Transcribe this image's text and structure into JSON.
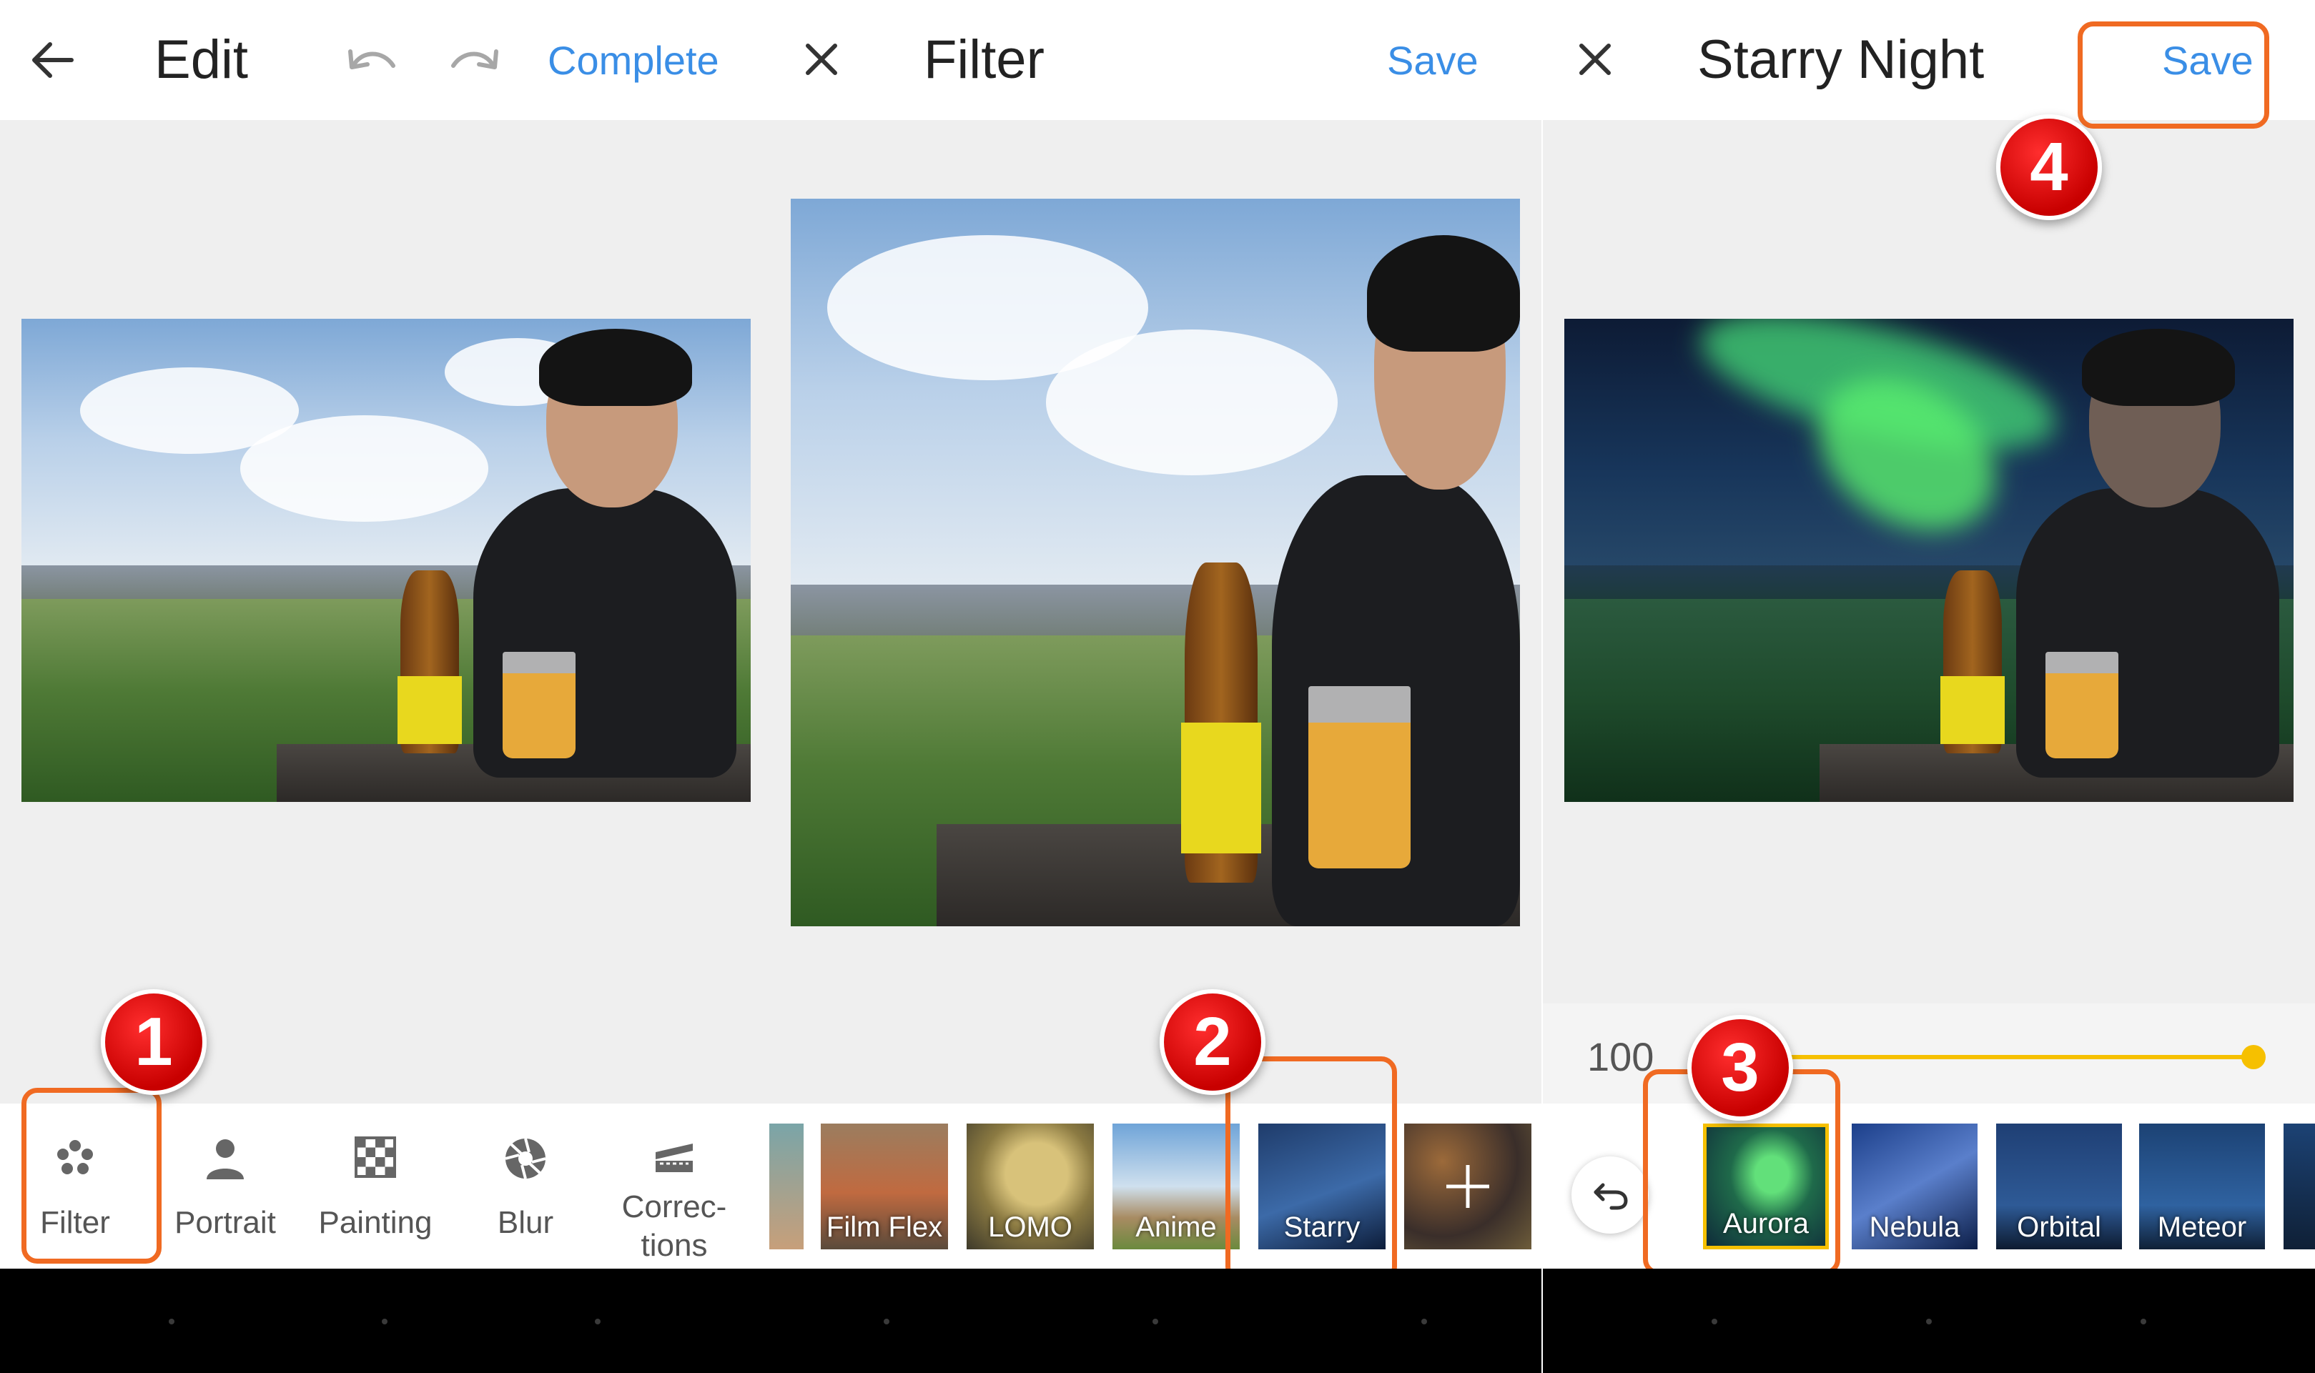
{
  "colors": {
    "accent": "#3a8ee6",
    "highlight": "#f06a22",
    "badge": "#d10000",
    "slider": "#f6c000"
  },
  "panel1": {
    "title": "Edit",
    "complete_label": "Complete",
    "tools": [
      {
        "label": "Filter",
        "icon": "filter-flower-icon"
      },
      {
        "label": "Portrait",
        "icon": "person-icon"
      },
      {
        "label": "Painting",
        "icon": "checker-icon"
      },
      {
        "label": "Blur",
        "icon": "aperture-icon"
      },
      {
        "label": "Correc-\ntions",
        "icon": "corrections-icon"
      }
    ],
    "badge": "1"
  },
  "panel2": {
    "title": "Filter",
    "save_label": "Save",
    "filters": [
      "Film Flex",
      "LOMO",
      "Anime",
      "Starry"
    ],
    "badge": "2"
  },
  "panel3": {
    "title": "Starry Night",
    "save_label": "Save",
    "slider_value": "100",
    "slider_level": 1.0,
    "effects": [
      "Aurora",
      "Nebula",
      "Orbital",
      "Meteor"
    ],
    "badge3": "3",
    "badge4": "4"
  }
}
